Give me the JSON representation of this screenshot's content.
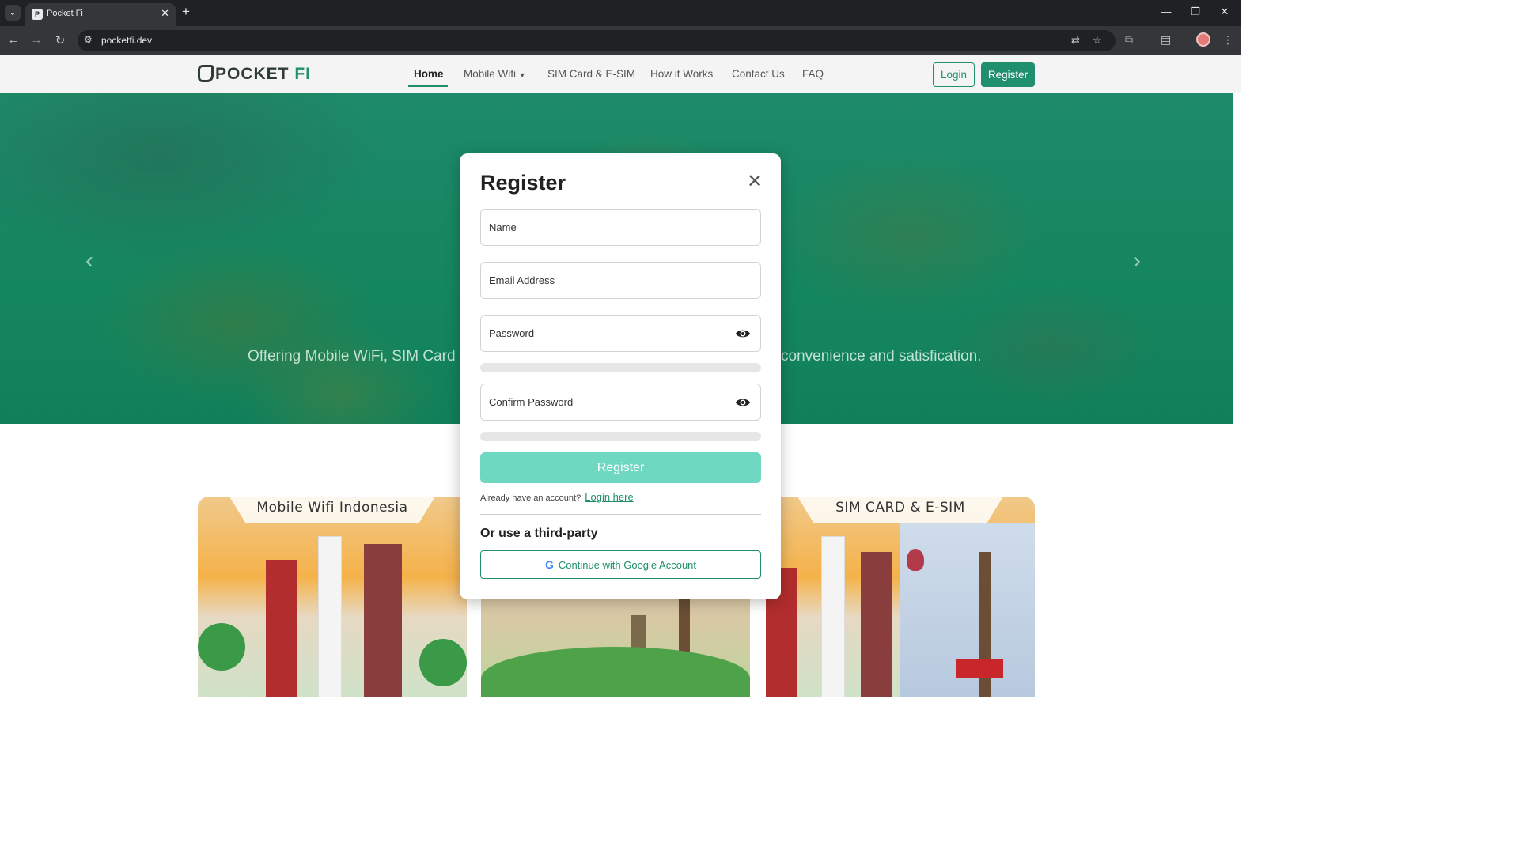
{
  "browser": {
    "tab_title": "Pocket Fi",
    "url": "pocketfi.dev",
    "new_tab": "+",
    "tab_close": "✕"
  },
  "site": {
    "logo_main": "POCKET",
    "logo_accent": "FI",
    "nav": {
      "home": "Home",
      "mobile_wifi": "Mobile Wifi",
      "sim_card": "SIM Card & E-SIM",
      "how_it_works": "How it Works",
      "contact": "Contact Us",
      "faq": "FAQ"
    },
    "login_btn": "Login",
    "register_btn": "Register"
  },
  "hero": {
    "text_left": "Offering Mobile WiFi, SIM Card",
    "text_right": "convenience and satisfication."
  },
  "cards": [
    {
      "title": "Mobile Wifi Indonesia"
    },
    {
      "title": "SIM CARD & E-SIM"
    }
  ],
  "modal": {
    "title": "Register",
    "fields": {
      "name": "Name",
      "email": "Email Address",
      "password": "Password",
      "confirm_password": "Confirm Password"
    },
    "submit": "Register",
    "have_account": "Already have an account?",
    "login_link": "Login here",
    "third_party": "Or use a third-party",
    "google": "Continue with Google Account"
  },
  "colors": {
    "brand": "#1f8f6d",
    "submit_disabled": "#6fd8c0"
  }
}
